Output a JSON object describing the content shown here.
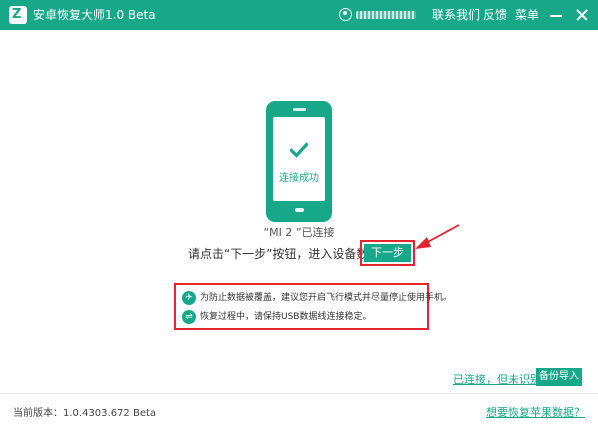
{
  "window": {
    "title": "安卓恢复大师1.0 Beta",
    "user_name": "",
    "menu": [
      "联系我们",
      "反馈",
      "菜单"
    ]
  },
  "icons": {
    "logo": "z-logo",
    "user": "user-icon",
    "minimize": "minimize-icon",
    "close": "close-icon",
    "check": "check-icon",
    "airplane": "airplane-icon",
    "usb": "usb-icon",
    "arrow": "red-arrow-icon"
  },
  "colors": {
    "accent": "#17a88a",
    "highlight": "#e3232f"
  },
  "phone": {
    "status_text": "连接成功"
  },
  "device": {
    "connected_label": "“MI 2 ”已连接"
  },
  "instruction": {
    "text": "请点击“下一步”按钮，进入设备数据扫描",
    "next_label": "下一步"
  },
  "tips": [
    "为防止数据被覆盖，建议您开启飞行模式并尽量停止使用手机。",
    "恢复过程中，请保持USB数据线连接稳定。"
  ],
  "links": {
    "connected_not_recognized": "已连接，但未识别？",
    "backup_import": "备份导入",
    "apple_recovery": "想要恢复苹果数据？"
  },
  "footer": {
    "version": "当前版本：1.0.4303.672 Beta"
  }
}
